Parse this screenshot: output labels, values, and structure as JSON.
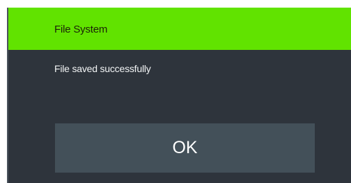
{
  "dialog": {
    "title": "File System",
    "message": "File saved successfully",
    "ok_label": "OK"
  },
  "colors": {
    "title_bar": "#61e300",
    "dialog_background": "#2e343c",
    "button_background": "#435059"
  }
}
